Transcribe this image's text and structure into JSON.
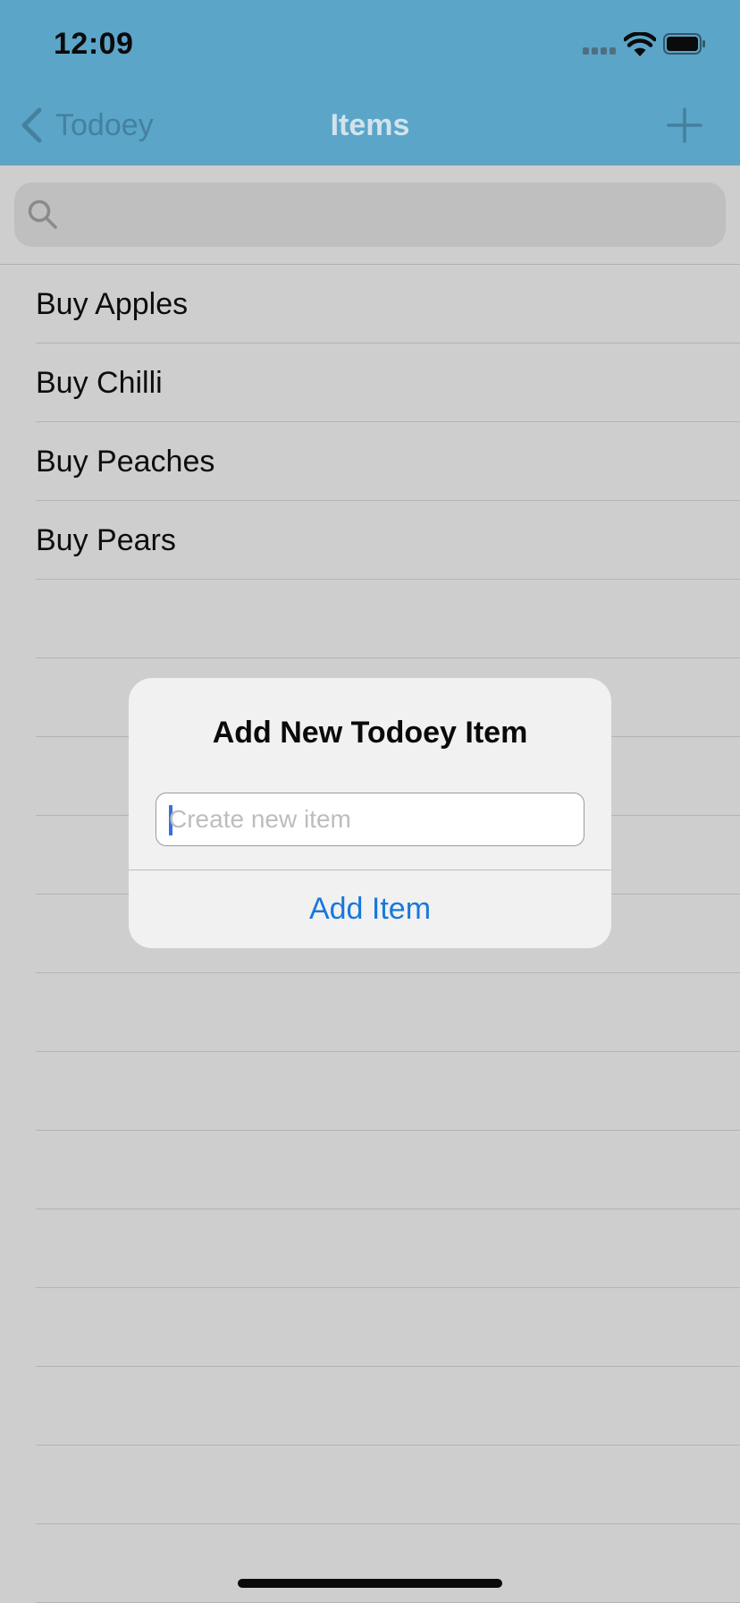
{
  "status_bar": {
    "time": "12:09"
  },
  "nav": {
    "back_label": "Todoey",
    "title": "Items"
  },
  "search": {
    "placeholder": ""
  },
  "items": [
    {
      "label": "Buy Apples"
    },
    {
      "label": "Buy Chilli"
    },
    {
      "label": "Buy Peaches"
    },
    {
      "label": "Buy Pears"
    },
    {
      "label": ""
    },
    {
      "label": ""
    },
    {
      "label": ""
    },
    {
      "label": ""
    },
    {
      "label": ""
    },
    {
      "label": ""
    },
    {
      "label": ""
    },
    {
      "label": ""
    },
    {
      "label": ""
    },
    {
      "label": ""
    },
    {
      "label": ""
    },
    {
      "label": ""
    },
    {
      "label": ""
    },
    {
      "label": ""
    }
  ],
  "alert": {
    "title": "Add New Todoey Item",
    "field_placeholder": "Create new item",
    "action_label": "Add Item"
  },
  "colors": {
    "nav_bar": "#5ba5c9",
    "background": "#cecece",
    "alert_action": "#1878dc"
  }
}
